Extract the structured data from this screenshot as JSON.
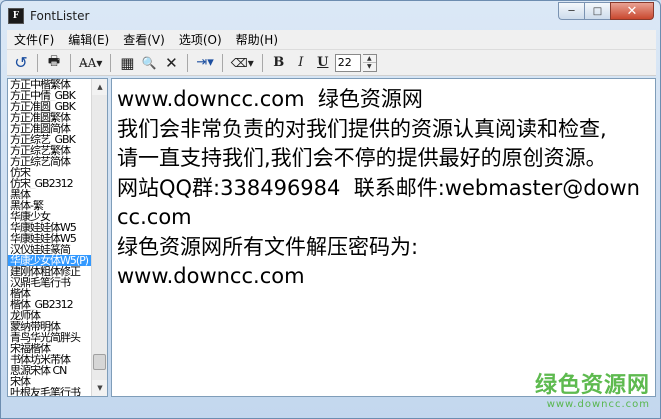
{
  "window": {
    "title": "FontLister",
    "min": "─",
    "max": "□",
    "close": "✕"
  },
  "menu": [
    {
      "label": "文件(F)"
    },
    {
      "label": "编辑(E)"
    },
    {
      "label": "查看(V)"
    },
    {
      "label": "选项(O)"
    },
    {
      "label": "帮助(H)"
    }
  ],
  "toolbar": {
    "refresh": "↺",
    "print": "🖶",
    "font_style": "A̶A▾",
    "grid": "▦",
    "preview": "🔍",
    "delete": "✕",
    "export": "⇥▾",
    "eraser": "⌫▾",
    "bold": "B",
    "italic": "I",
    "underline": "U",
    "size_value": "22",
    "spin_up": "▲",
    "spin_down": "▼"
  },
  "icons": {
    "refresh": "refresh-icon",
    "print": "printer-icon",
    "font": "font-style-icon",
    "grid": "grid-icon",
    "preview": "preview-icon",
    "delete": "delete-icon",
    "export": "export-icon",
    "eraser": "eraser-icon"
  },
  "font_list": {
    "selected_index": 16,
    "items": [
      "方正中楷繁体",
      "方正中倩_GBK",
      "方正准圆_GBK",
      "方正准圆繁体",
      "方正准圆简体",
      "方正综艺_GBK",
      "方正综艺繁体",
      "方正综艺简体",
      "仿宋",
      "仿宋_GB2312",
      "黑体",
      "黑体-繁",
      "华康少女",
      "华康娃娃体W5",
      "华康娃娃体W5",
      "汉仪娃娃篆简",
      "华康少女体W5(P)",
      "建刚体粗体修正",
      "汉鼎毛笔行书",
      "楷体",
      "楷体_GB2312",
      "龙师体",
      "蒙纳带明体",
      "青鸟华光简胖头",
      "宋福楷体",
      "书体坊米芾体",
      "思源宋体 CN",
      "宋体",
      "叶根友毛笔行书"
    ],
    "scroll_up": "▲",
    "scroll_down": "▼"
  },
  "preview": {
    "text": "www.downcc.com  绿色资源网\n我们会非常负责的对我们提供的资源认真阅读和检查,\n请一直支持我们,我们会不停的提供最好的原创资源。\n网站QQ群:338496984  联系邮件:webmaster@downcc.com\n绿色资源网所有文件解压密码为:\nwww.downcc.com"
  },
  "watermark": {
    "main": "绿色资源网",
    "url": "www.downcc.com"
  }
}
